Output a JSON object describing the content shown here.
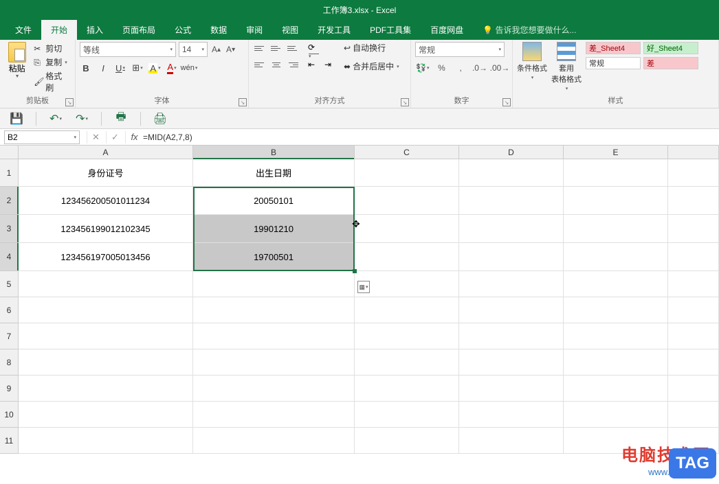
{
  "window": {
    "title": "工作簿3.xlsx - Excel"
  },
  "tabs": {
    "file": "文件",
    "home": "开始",
    "insert": "插入",
    "layout": "页面布局",
    "formula": "公式",
    "data": "数据",
    "review": "审阅",
    "view": "视图",
    "dev": "开发工具",
    "pdf": "PDF工具集",
    "baidu": "百度网盘",
    "tellme": "告诉我您想要做什么..."
  },
  "ribbon": {
    "clipboard": {
      "label": "剪贴板",
      "paste": "粘贴",
      "cut": "剪切",
      "copy": "复制",
      "brush": "格式刷"
    },
    "font": {
      "label": "字体",
      "name": "等线",
      "size": "14"
    },
    "align": {
      "label": "对齐方式",
      "wrap": "自动换行",
      "merge": "合并后居中"
    },
    "number": {
      "label": "数字",
      "format": "常规"
    },
    "styles": {
      "label": "样式",
      "cond": "条件格式",
      "table": "套用\n表格格式",
      "bad": "差_Sheet4",
      "good": "好_Sheet4",
      "normal": "常规",
      "bad2": "差"
    }
  },
  "formulaBar": {
    "cellRef": "B2",
    "formula": "=MID(A2,7,8)"
  },
  "columns": [
    "A",
    "B",
    "C",
    "D",
    "E"
  ],
  "colWidths": {
    "A": 254,
    "B": 235,
    "other": 152
  },
  "rowHeader": {
    "h1": 40,
    "hData": 41,
    "hEmpty": 38
  },
  "sheet": {
    "headers": {
      "id": "身份证号",
      "dob": "出生日期"
    },
    "rows": [
      {
        "id": "123456200501011234",
        "dob": "20050101"
      },
      {
        "id": "123456199012102345",
        "dob": "19901210"
      },
      {
        "id": "123456197005013456",
        "dob": "19700501"
      }
    ]
  },
  "watermark": {
    "text": "电脑技术网",
    "url": "www.tagxp.com",
    "badge": "TAG"
  }
}
